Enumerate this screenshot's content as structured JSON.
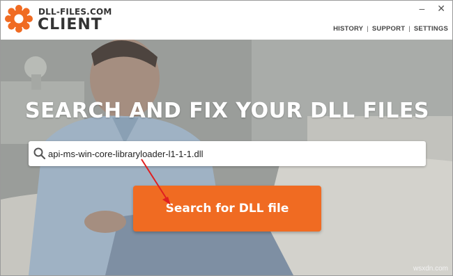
{
  "app": {
    "brand_line1": "DLL-FILES.COM",
    "brand_line2": "CLIENT",
    "logo_icon": "gear-logo-icon",
    "accent_color": "#f06b22"
  },
  "window_controls": {
    "minimize": "–",
    "close": "✕"
  },
  "nav": {
    "items": [
      {
        "label": "HISTORY"
      },
      {
        "label": "SUPPORT"
      },
      {
        "label": "SETTINGS"
      }
    ],
    "separator": "|"
  },
  "hero": {
    "title": "SEARCH AND FIX YOUR DLL FILES"
  },
  "search": {
    "value": "api-ms-win-core-libraryloader-l1-1-1.dll",
    "icon": "search-icon",
    "button_label": "Search for DLL file"
  },
  "watermark": "wsxdn.com"
}
